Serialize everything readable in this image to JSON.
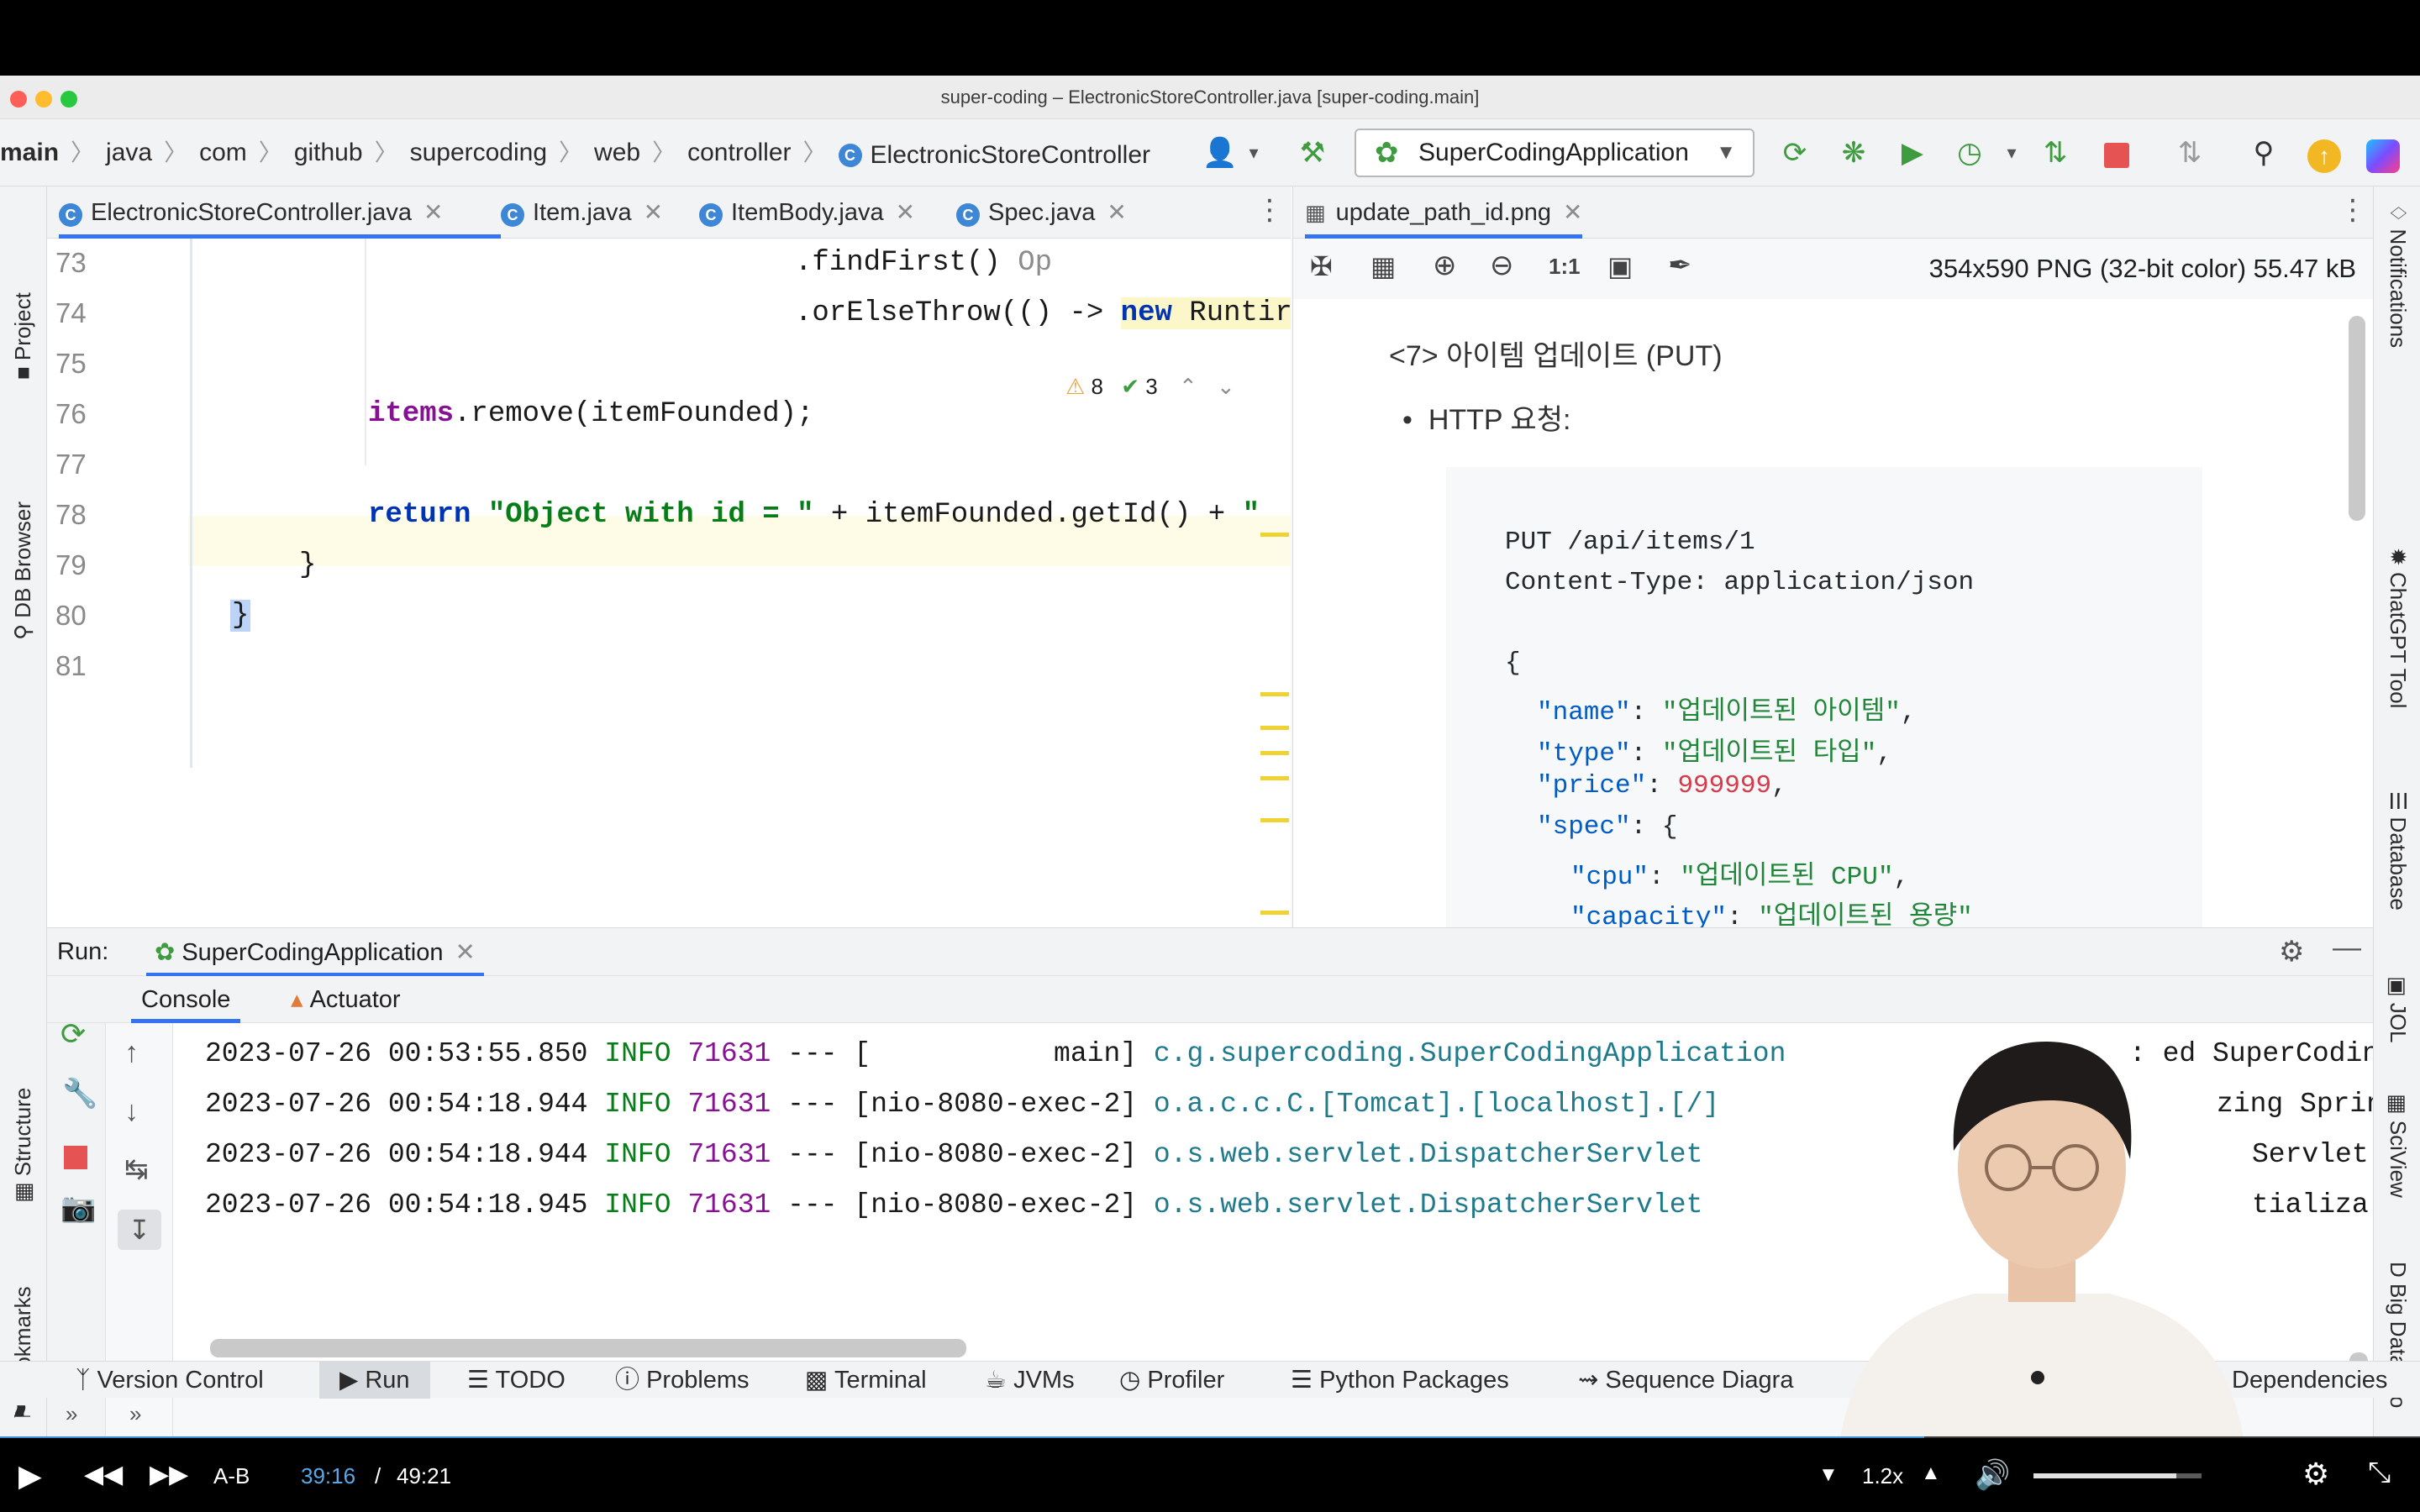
{
  "window": {
    "title": "super-coding – ElectronicStoreController.java [super-coding.main]"
  },
  "breadcrumb": [
    "main",
    "java",
    "com",
    "github",
    "supercoding",
    "web",
    "controller",
    "ElectronicStoreController"
  ],
  "run_config": {
    "label": "SuperCodingApplication"
  },
  "editor_tabs": [
    {
      "label": "ElectronicStoreController.java"
    },
    {
      "label": "Item.java"
    },
    {
      "label": "ItemBody.java"
    },
    {
      "label": "Spec.java"
    }
  ],
  "inspections": {
    "warnings": "8",
    "ok": "3"
  },
  "code": {
    "line_numbers": [
      "73",
      "74",
      "75",
      "76",
      "77",
      "78",
      "79",
      "80",
      "81"
    ],
    "l73": {
      "a": ".findFirst() ",
      "b": "Op"
    },
    "l74": {
      "a": ".orElseThrow(() -> ",
      "kw": "new ",
      "b": "Runtir"
    },
    "l76": {
      "fld": "items",
      "rest": ".remove(itemFounded);"
    },
    "l78": {
      "kw": "return ",
      "str": "\"Object with id = \"",
      "rest": " + itemFounded.getId() + ",
      "str2": "\""
    },
    "l79": "}",
    "l80": "}"
  },
  "image_viewer": {
    "tab_label": "update_path_id.png",
    "info": "354x590 PNG (32-bit color) 55.47 kB",
    "zoom_reset_label": "1:1",
    "heading": "<7> 아이템 업데이트 (PUT)",
    "bullet": "HTTP 요청:",
    "request_line": "PUT /api/items/1",
    "content_type": "Content-Type: application/json",
    "json_open": "{",
    "name_key": "\"name\"",
    "name_val": "\"업데이트된 아이템\"",
    "type_key": "\"type\"",
    "type_val": "\"업데이트된 타입\"",
    "price_key": "\"price\"",
    "price_val": "999999",
    "spec_key": "\"spec\"",
    "spec_open": "{",
    "cpu_key": "\"cpu\"",
    "cpu_val": "\"업데이트된 CPU\"",
    "cap_key": "\"capacity\"",
    "cap_val": "\"업데이트된 용량\""
  },
  "run_panel": {
    "label": "Run:",
    "config_tab": "SuperCodingApplication",
    "console_tab": "Console",
    "actuator_tab": "Actuator",
    "logs": [
      {
        "ts": "2023-07-26 00:53:55.850",
        "lvl": "INFO",
        "pid": "71631",
        "sep": "---",
        "thread": "[           main]",
        "cls": "c.g.supercoding.SuperCodingApplication",
        "msg": ": ed SuperCodingA"
      },
      {
        "ts": "2023-07-26 00:54:18.944",
        "lvl": "INFO",
        "pid": "71631",
        "sep": "---",
        "thread": "[nio-8080-exec-2]",
        "cls": "o.a.c.c.C.[Tomcat].[localhost].[/]",
        "msg": "zing Spring"
      },
      {
        "ts": "2023-07-26 00:54:18.944",
        "lvl": "INFO",
        "pid": "71631",
        "sep": "---",
        "thread": "[nio-8080-exec-2]",
        "cls": "o.s.web.servlet.DispatcherServlet",
        "msg": "Servlet"
      },
      {
        "ts": "2023-07-26 00:54:18.945",
        "lvl": "INFO",
        "pid": "71631",
        "sep": "---",
        "thread": "[nio-8080-exec-2]",
        "cls": "o.s.web.servlet.DispatcherServlet",
        "msg": "tializa"
      }
    ]
  },
  "left_strip": {
    "project": "Project",
    "db_browser": "DB Browser",
    "structure": "Structure",
    "bookmarks": "Bookmarks"
  },
  "right_strip": {
    "notifications": "Notifications",
    "chatgpt": "ChatGPT Tool",
    "database": "Database",
    "jol": "JOL",
    "sciview": "SciView",
    "bigdata": "Big Data Too"
  },
  "bottom_tools": [
    "Version Control",
    "Run",
    "TODO",
    "Problems",
    "Terminal",
    "JVMs",
    "Profiler",
    "Python Packages",
    "Sequence Diagra",
    "Dependencies"
  ],
  "player": {
    "ab": "A-B",
    "current": "39:16",
    "sep": "/",
    "total": "49:21",
    "speed": "1.2x",
    "progress": 0.795,
    "volume": 0.85
  },
  "colors": {
    "accent": "#3574f0",
    "progress": "#3b8fd6",
    "run_red": "#e55353",
    "build_green": "#3f9b3f"
  }
}
